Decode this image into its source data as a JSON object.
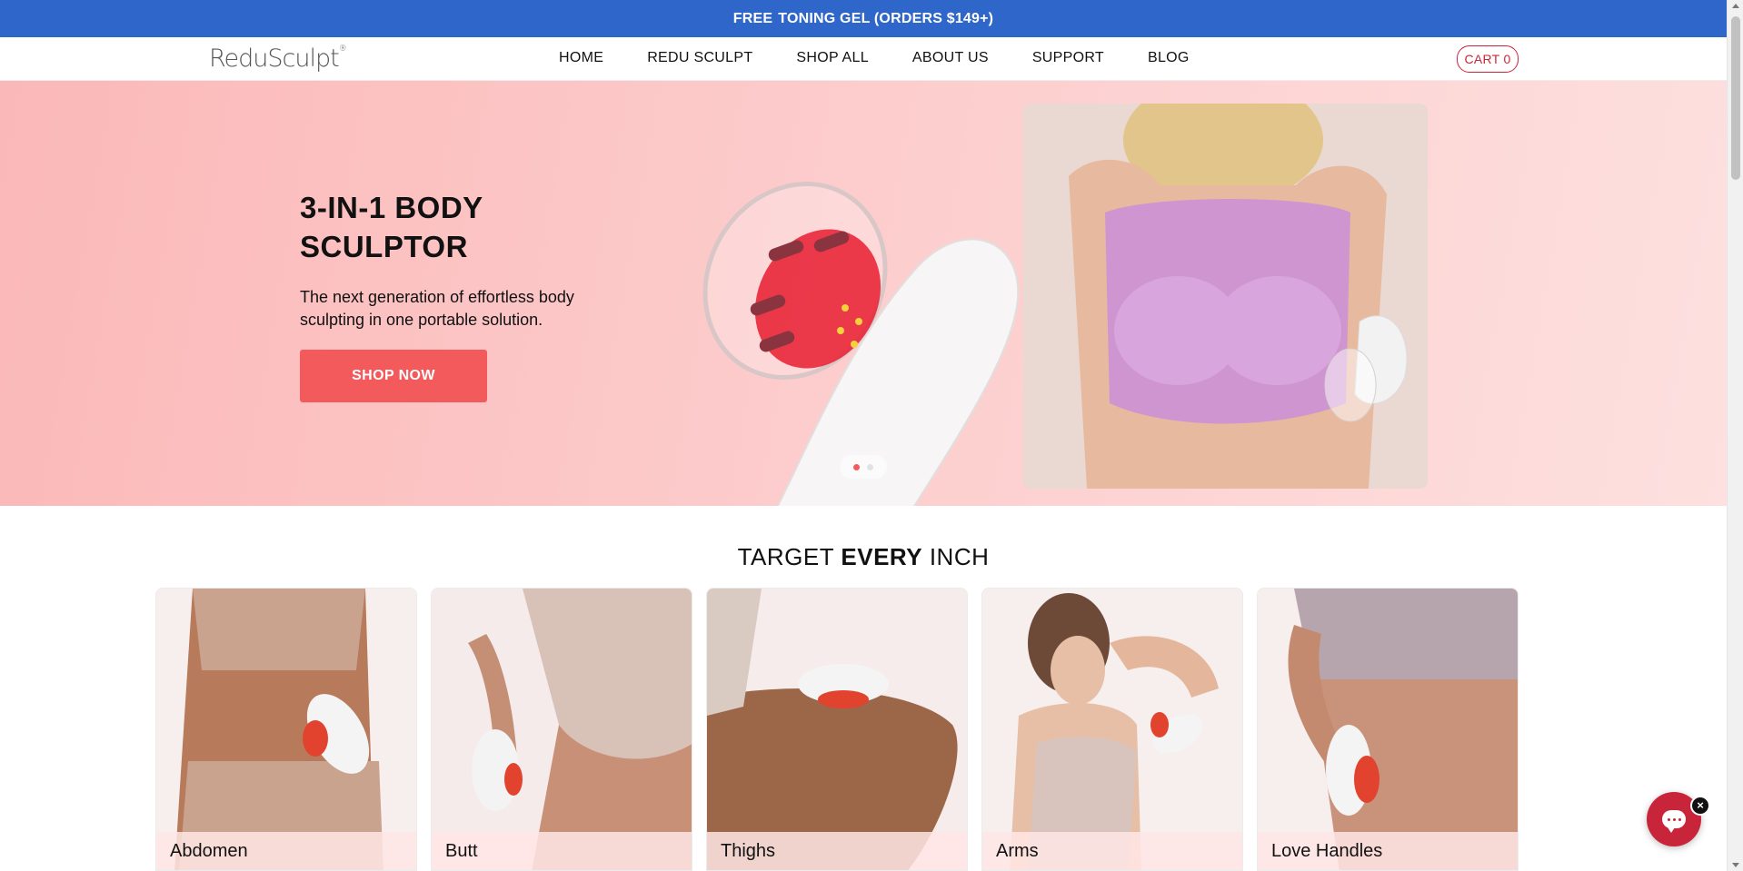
{
  "announcement": {
    "highlight": "FREE",
    "text": "TONING GEL (ORDERS $149+)"
  },
  "header": {
    "logo": "ReduSculpt",
    "nav": [
      "HOME",
      "REDU SCULPT",
      "SHOP ALL",
      "ABOUT US",
      "SUPPORT",
      "BLOG"
    ],
    "cart_label": "CART 0"
  },
  "hero": {
    "title_line1": "3-IN-1 BODY",
    "title_line2": "SCULPTOR",
    "subtitle": "The next generation of effortless body sculpting in one portable solution.",
    "cta": "SHOP NOW",
    "slides_total": 2,
    "slide_active": 1
  },
  "section": {
    "title_pre": "TARGET",
    "title_bold": "EVERY",
    "title_post": "INCH",
    "cards": [
      {
        "label": "Abdomen"
      },
      {
        "label": "Butt"
      },
      {
        "label": "Thighs"
      },
      {
        "label": "Arms"
      },
      {
        "label": "Love Handles"
      }
    ]
  },
  "colors": {
    "announcement_bg": "#2f66c9",
    "accent": "#f25a5c",
    "cart_border": "#c9253a",
    "hero_bg": "#fbb8b8"
  },
  "icons": [
    "chat-icon",
    "close-icon"
  ]
}
